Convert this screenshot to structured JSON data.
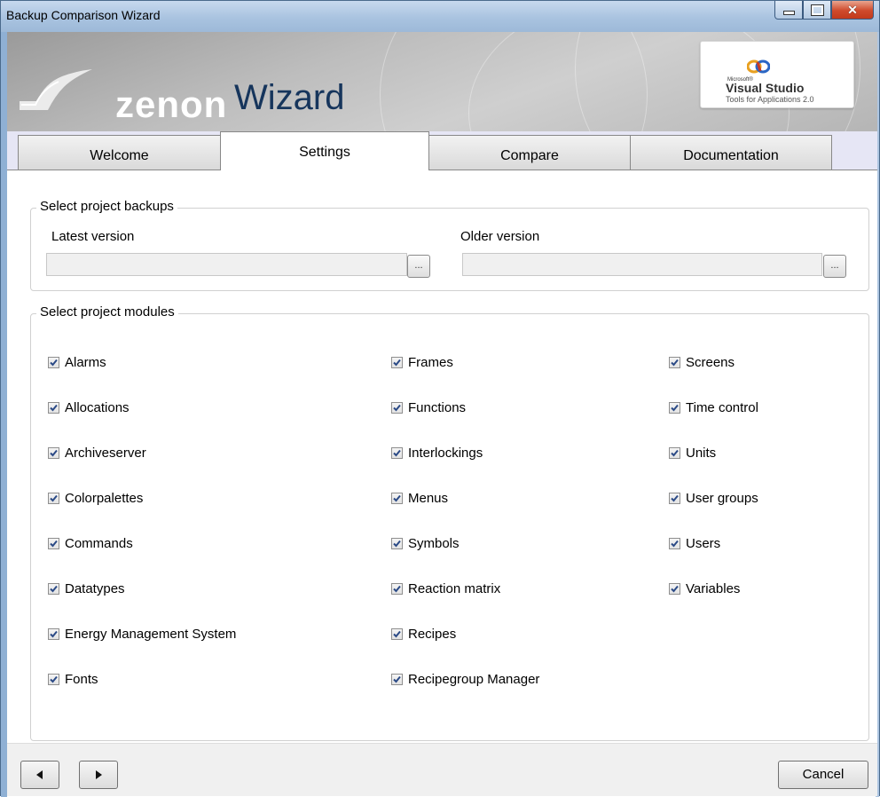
{
  "window": {
    "title": "Backup Comparison Wizard"
  },
  "banner": {
    "brand": "zenon",
    "product": "Wizard",
    "vs_badge": {
      "microsoft": "Microsoft®",
      "name": "Visual Studio",
      "subtitle": "Tools for Applications 2.0"
    }
  },
  "tabs": [
    {
      "label": "Welcome",
      "active": false
    },
    {
      "label": "Settings",
      "active": true
    },
    {
      "label": "Compare",
      "active": false
    },
    {
      "label": "Documentation",
      "active": false
    }
  ],
  "backups": {
    "legend": "Select project backups",
    "latest": {
      "label": "Latest  version",
      "value": ""
    },
    "older": {
      "label": "Older version",
      "value": ""
    },
    "browse_label": "..."
  },
  "modules": {
    "legend": "Select project modules",
    "col1": [
      {
        "label": "Alarms",
        "checked": true
      },
      {
        "label": "Allocations",
        "checked": true
      },
      {
        "label": "Archiveserver",
        "checked": true
      },
      {
        "label": "Colorpalettes",
        "checked": true
      },
      {
        "label": "Commands",
        "checked": true
      },
      {
        "label": "Datatypes",
        "checked": true
      },
      {
        "label": "Energy Management System",
        "checked": true
      },
      {
        "label": "Fonts",
        "checked": true
      }
    ],
    "col2": [
      {
        "label": "Frames",
        "checked": true
      },
      {
        "label": "Functions",
        "checked": true
      },
      {
        "label": "Interlockings",
        "checked": true
      },
      {
        "label": "Menus",
        "checked": true
      },
      {
        "label": "Symbols",
        "checked": true
      },
      {
        "label": "Reaction matrix",
        "checked": true
      },
      {
        "label": "Recipes",
        "checked": true
      },
      {
        "label": "Recipegroup Manager",
        "checked": true
      }
    ],
    "col3": [
      {
        "label": "Screens",
        "checked": true
      },
      {
        "label": "Time control",
        "checked": true
      },
      {
        "label": "Units",
        "checked": true
      },
      {
        "label": "User groups",
        "checked": true
      },
      {
        "label": "Users",
        "checked": true
      },
      {
        "label": "Variables",
        "checked": true
      }
    ]
  },
  "footer": {
    "back_icon": "arrow-left-icon",
    "forward_icon": "arrow-right-icon",
    "cancel_label": "Cancel"
  },
  "colors": {
    "titlebar": "#a9c3e0",
    "wizard_text": "#16355c",
    "tab_strip": "#e6e6f5",
    "close_button": "#cf4a2c"
  }
}
